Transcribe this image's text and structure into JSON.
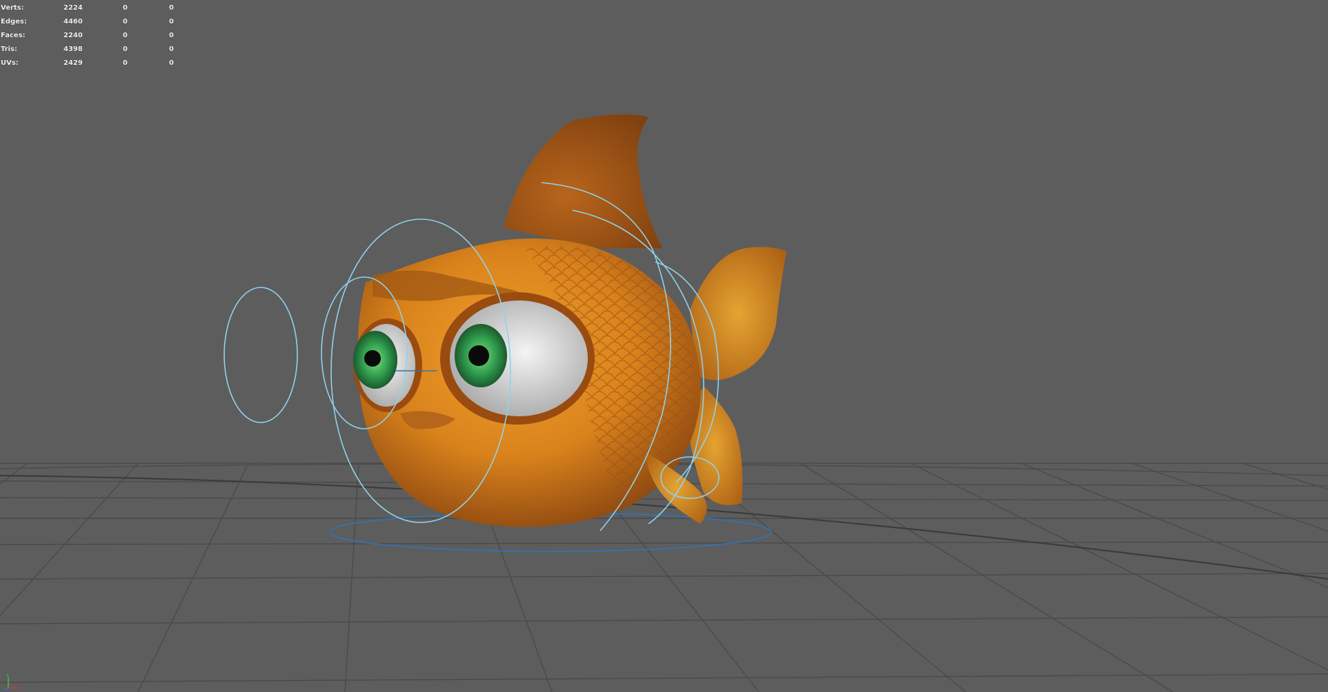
{
  "hud": {
    "stats": [
      {
        "label": "Verts:",
        "values": [
          "2224",
          "0",
          "0"
        ]
      },
      {
        "label": "Edges:",
        "values": [
          "4460",
          "0",
          "0"
        ]
      },
      {
        "label": "Faces:",
        "values": [
          "2240",
          "0",
          "0"
        ]
      },
      {
        "label": "Tris:",
        "values": [
          "4398",
          "0",
          "0"
        ]
      },
      {
        "label": "UVs:",
        "values": [
          "2429",
          "0",
          "0"
        ]
      }
    ]
  },
  "axis_gizmo": {
    "labels": [
      "Y",
      "X"
    ]
  },
  "colors": {
    "viewport_bg": "#5d5d5d",
    "grid": "#4a4a4a",
    "nurbs_curve": "#8fd3ee",
    "selected_curve": "#3a6fa8",
    "fish_body": "#d9821c",
    "iris": "#2e9a4c"
  },
  "icons": [
    "goldfish-model",
    "eye-control-curve",
    "root-control-curve",
    "view-axis-icon"
  ]
}
